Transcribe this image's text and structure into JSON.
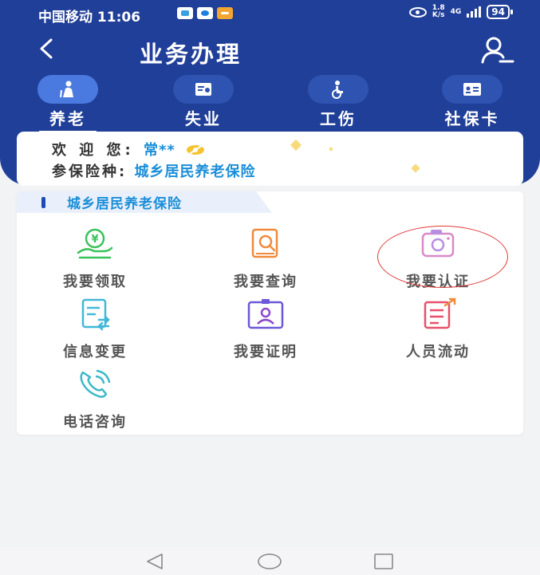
{
  "status_bar": {
    "carrier": "中国移动",
    "time": "11:06",
    "net_speed": "1.8",
    "net_speed_unit": "K/s",
    "network": "4G",
    "battery": "94"
  },
  "header": {
    "title": "业务办理"
  },
  "tabs": [
    {
      "label": "养老",
      "icon": "elderly-icon",
      "active": true
    },
    {
      "label": "失业",
      "icon": "unemployment-icon",
      "active": false
    },
    {
      "label": "工伤",
      "icon": "injury-icon",
      "active": false
    },
    {
      "label": "社保卡",
      "icon": "social-security-card-icon",
      "active": false
    }
  ],
  "welcome": {
    "greeting_label": "欢 迎 您:",
    "user_name": "常**",
    "insurance_label": "参保险种:",
    "insurance_type": "城乡居民养老保险"
  },
  "service_card": {
    "title": "城乡居民养老保险",
    "items": [
      {
        "label": "我要领取",
        "icon": "money-hand-icon"
      },
      {
        "label": "我要查询",
        "icon": "search-document-icon"
      },
      {
        "label": "我要认证",
        "icon": "camera-icon"
      },
      {
        "label": "信息变更",
        "icon": "info-change-icon"
      },
      {
        "label": "我要证明",
        "icon": "id-certificate-icon"
      },
      {
        "label": "人员流动",
        "icon": "personnel-transfer-icon"
      },
      {
        "label": "电话咨询",
        "icon": "phone-icon"
      }
    ]
  },
  "colors": {
    "header_blue": "#203f98",
    "accent_blue": "#1a8ed8",
    "highlight_red": "#e23a3a"
  }
}
